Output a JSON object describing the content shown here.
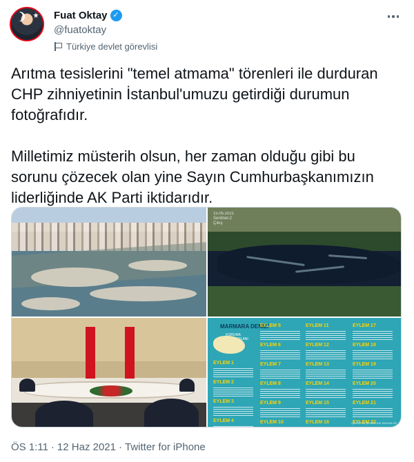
{
  "author": {
    "name": "Fuat Oktay",
    "handle": "@fuatoktay",
    "label": "Türkiye devlet görevlisi"
  },
  "tweet": {
    "text": "Arıtma tesislerini \"temel atmama\" törenleri ile durduran CHP zihniyetinin İstanbul'umuzu getirdiği durumun fotoğrafıdır.\n\nMilletimiz müsterih olsun, her zaman olduğu gibi bu sorunu çözecek olan yine Sayın Cumhurbaşkanımızın liderliğinde AK Parti iktidarıdır."
  },
  "media": {
    "satellite_stamp": "15.05.2021\nSentinel-2\nÇıkış",
    "infographic": {
      "title": "MARMARA DENİZİ",
      "subtitle": "KORUMA\nEYLEM PLANI",
      "col1": [
        "EYLEM 1",
        "EYLEM 2",
        "EYLEM 3",
        "EYLEM 4"
      ],
      "col2": [
        "EYLEM 5",
        "EYLEM 6",
        "EYLEM 7",
        "EYLEM 8",
        "EYLEM 9",
        "EYLEM 10"
      ],
      "col3": [
        "EYLEM 11",
        "EYLEM 12",
        "EYLEM 13",
        "EYLEM 14",
        "EYLEM 15",
        "EYLEM 16"
      ],
      "col4": [
        "EYLEM 17",
        "EYLEM 18",
        "EYLEM 19",
        "EYLEM 20",
        "EYLEM 21",
        "EYLEM 22"
      ],
      "footer": "ÇEVRE VE ŞEHİRCİLİK BAKANLIĞI"
    }
  },
  "meta": {
    "time": "ÖS 1:11",
    "separator": "·",
    "date": "12 Haz 2021",
    "source": "Twitter for iPhone"
  },
  "icons": {
    "verified": "verified-badge-icon",
    "label": "flag-icon",
    "more": "more-options-icon"
  },
  "colors": {
    "verified": "#1d9bf0",
    "secondary_text": "#536471",
    "primary_text": "#0f1419"
  }
}
